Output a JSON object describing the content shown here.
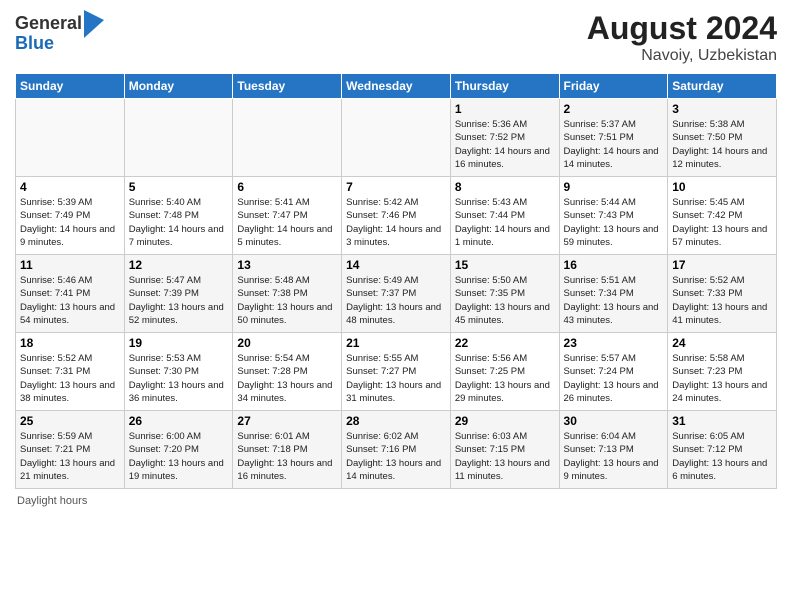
{
  "header": {
    "logo_general": "General",
    "logo_blue": "Blue",
    "month_year": "August 2024",
    "location": "Navoiy, Uzbekistan"
  },
  "weekdays": [
    "Sunday",
    "Monday",
    "Tuesday",
    "Wednesday",
    "Thursday",
    "Friday",
    "Saturday"
  ],
  "footer": {
    "daylight_label": "Daylight hours"
  },
  "weeks": [
    [
      {
        "day": "",
        "info": ""
      },
      {
        "day": "",
        "info": ""
      },
      {
        "day": "",
        "info": ""
      },
      {
        "day": "",
        "info": ""
      },
      {
        "day": "1",
        "info": "Sunrise: 5:36 AM\nSunset: 7:52 PM\nDaylight: 14 hours and 16 minutes."
      },
      {
        "day": "2",
        "info": "Sunrise: 5:37 AM\nSunset: 7:51 PM\nDaylight: 14 hours and 14 minutes."
      },
      {
        "day": "3",
        "info": "Sunrise: 5:38 AM\nSunset: 7:50 PM\nDaylight: 14 hours and 12 minutes."
      }
    ],
    [
      {
        "day": "4",
        "info": "Sunrise: 5:39 AM\nSunset: 7:49 PM\nDaylight: 14 hours and 9 minutes."
      },
      {
        "day": "5",
        "info": "Sunrise: 5:40 AM\nSunset: 7:48 PM\nDaylight: 14 hours and 7 minutes."
      },
      {
        "day": "6",
        "info": "Sunrise: 5:41 AM\nSunset: 7:47 PM\nDaylight: 14 hours and 5 minutes."
      },
      {
        "day": "7",
        "info": "Sunrise: 5:42 AM\nSunset: 7:46 PM\nDaylight: 14 hours and 3 minutes."
      },
      {
        "day": "8",
        "info": "Sunrise: 5:43 AM\nSunset: 7:44 PM\nDaylight: 14 hours and 1 minute."
      },
      {
        "day": "9",
        "info": "Sunrise: 5:44 AM\nSunset: 7:43 PM\nDaylight: 13 hours and 59 minutes."
      },
      {
        "day": "10",
        "info": "Sunrise: 5:45 AM\nSunset: 7:42 PM\nDaylight: 13 hours and 57 minutes."
      }
    ],
    [
      {
        "day": "11",
        "info": "Sunrise: 5:46 AM\nSunset: 7:41 PM\nDaylight: 13 hours and 54 minutes."
      },
      {
        "day": "12",
        "info": "Sunrise: 5:47 AM\nSunset: 7:39 PM\nDaylight: 13 hours and 52 minutes."
      },
      {
        "day": "13",
        "info": "Sunrise: 5:48 AM\nSunset: 7:38 PM\nDaylight: 13 hours and 50 minutes."
      },
      {
        "day": "14",
        "info": "Sunrise: 5:49 AM\nSunset: 7:37 PM\nDaylight: 13 hours and 48 minutes."
      },
      {
        "day": "15",
        "info": "Sunrise: 5:50 AM\nSunset: 7:35 PM\nDaylight: 13 hours and 45 minutes."
      },
      {
        "day": "16",
        "info": "Sunrise: 5:51 AM\nSunset: 7:34 PM\nDaylight: 13 hours and 43 minutes."
      },
      {
        "day": "17",
        "info": "Sunrise: 5:52 AM\nSunset: 7:33 PM\nDaylight: 13 hours and 41 minutes."
      }
    ],
    [
      {
        "day": "18",
        "info": "Sunrise: 5:52 AM\nSunset: 7:31 PM\nDaylight: 13 hours and 38 minutes."
      },
      {
        "day": "19",
        "info": "Sunrise: 5:53 AM\nSunset: 7:30 PM\nDaylight: 13 hours and 36 minutes."
      },
      {
        "day": "20",
        "info": "Sunrise: 5:54 AM\nSunset: 7:28 PM\nDaylight: 13 hours and 34 minutes."
      },
      {
        "day": "21",
        "info": "Sunrise: 5:55 AM\nSunset: 7:27 PM\nDaylight: 13 hours and 31 minutes."
      },
      {
        "day": "22",
        "info": "Sunrise: 5:56 AM\nSunset: 7:25 PM\nDaylight: 13 hours and 29 minutes."
      },
      {
        "day": "23",
        "info": "Sunrise: 5:57 AM\nSunset: 7:24 PM\nDaylight: 13 hours and 26 minutes."
      },
      {
        "day": "24",
        "info": "Sunrise: 5:58 AM\nSunset: 7:23 PM\nDaylight: 13 hours and 24 minutes."
      }
    ],
    [
      {
        "day": "25",
        "info": "Sunrise: 5:59 AM\nSunset: 7:21 PM\nDaylight: 13 hours and 21 minutes."
      },
      {
        "day": "26",
        "info": "Sunrise: 6:00 AM\nSunset: 7:20 PM\nDaylight: 13 hours and 19 minutes."
      },
      {
        "day": "27",
        "info": "Sunrise: 6:01 AM\nSunset: 7:18 PM\nDaylight: 13 hours and 16 minutes."
      },
      {
        "day": "28",
        "info": "Sunrise: 6:02 AM\nSunset: 7:16 PM\nDaylight: 13 hours and 14 minutes."
      },
      {
        "day": "29",
        "info": "Sunrise: 6:03 AM\nSunset: 7:15 PM\nDaylight: 13 hours and 11 minutes."
      },
      {
        "day": "30",
        "info": "Sunrise: 6:04 AM\nSunset: 7:13 PM\nDaylight: 13 hours and 9 minutes."
      },
      {
        "day": "31",
        "info": "Sunrise: 6:05 AM\nSunset: 7:12 PM\nDaylight: 13 hours and 6 minutes."
      }
    ]
  ]
}
